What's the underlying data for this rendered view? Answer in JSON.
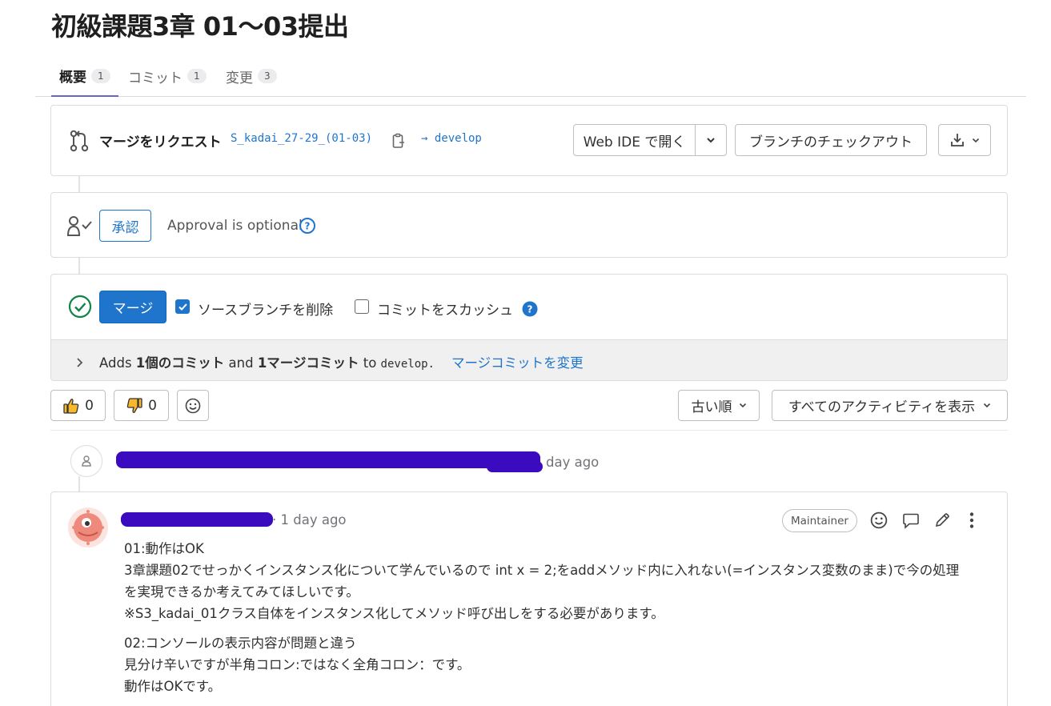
{
  "title": "初級課題3章 01〜03提出",
  "tabs": [
    {
      "label": "概要",
      "count": "1"
    },
    {
      "label": "コミット",
      "count": "1"
    },
    {
      "label": "変更",
      "count": "3"
    }
  ],
  "merge_request": {
    "label": "マージをリクエスト",
    "source_branch": "S_kadai_27-29_(01-03)",
    "arrow_target": "→ develop",
    "web_ide_label": "Web IDE で開く",
    "checkout_label": "ブランチのチェックアウト"
  },
  "approval": {
    "approve_label": "承認",
    "optional_text": "Approval is optional"
  },
  "merge": {
    "merge_label": "マージ",
    "delete_source_label": "ソースブランチを削除",
    "squash_label": "コミットをスカッシュ",
    "delete_source_checked": true,
    "squash_checked": false,
    "summary_prefix": "Adds ",
    "summary_commits": "1個のコミット",
    "summary_and": " and ",
    "summary_merge": "1マージコミット",
    "summary_to": " to ",
    "summary_branch": "develop.",
    "change_merge_commit_link": "マージコミットを変更"
  },
  "reactions": {
    "thumbs_up_count": "0",
    "thumbs_down_count": "0"
  },
  "filters": {
    "sort_label": "古い順",
    "activity_label": "すべてのアクティビティを表示"
  },
  "system_note": {
    "time_text": "day ago"
  },
  "comment": {
    "time_text": "· 1 day ago",
    "role_badge": "Maintainer",
    "paragraphs": [
      [
        "01:動作はOK",
        "3章課題02でせっかくインスタンス化について学んでいるので int x = 2;をaddメソッド内に入れない(=インスタンス変数のまま)で今の処理",
        "を実現できるか考えてみてほしいです。",
        "※S3_kadai_01クラス自体をインスタンス化してメソッド呼び出しをする必要があります。"
      ],
      [
        "02:コンソールの表示内容が問題と違う",
        "見分け辛いですが半角コロン:ではなく全角コロン：です。",
        "動作はOKです。"
      ]
    ]
  },
  "colors": {
    "primary_blue": "#1f75cb",
    "redaction": "#3a0bbf",
    "success_green": "#108548",
    "tab_underline": "#6666c4"
  }
}
